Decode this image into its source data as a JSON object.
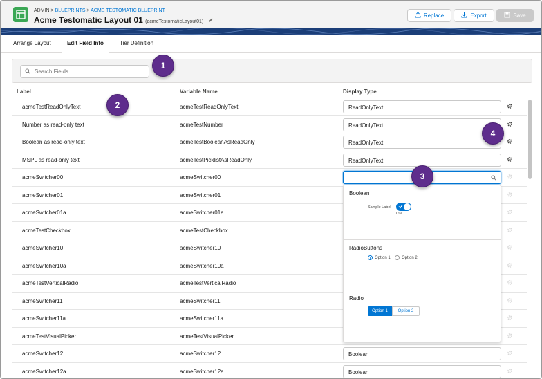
{
  "header": {
    "crumbs": {
      "root": "ADMIN",
      "sep1": ">",
      "blueprints": "BLUEPRINTS",
      "sep2": ">",
      "current": "ACME TESTOMATIC BLUEPRINT"
    },
    "title": "Acme Testomatic Layout 01",
    "api_name": "(acmeTestomaticLayout01)",
    "buttons": {
      "replace": "Replace",
      "export": "Export",
      "save": "Save"
    }
  },
  "tabs": [
    "Arrange Layout",
    "Edit Field Info",
    "Tier Definition"
  ],
  "active_tab": "Edit Field Info",
  "search": {
    "placeholder": "Search Fields",
    "value": ""
  },
  "columns": {
    "label": "Label",
    "variable": "Variable Name",
    "display": "Display Type"
  },
  "rows": [
    {
      "label": "acmeTestReadOnlyText",
      "variable": "acmeTestReadOnlyText",
      "display": "ReadOnlyText"
    },
    {
      "label": "Number as read-only text",
      "variable": "acmeTestNumber",
      "display": "ReadOnlyText"
    },
    {
      "label": "Boolean as read-only text",
      "variable": "acmeTestBooleanAsReadOnly",
      "display": "ReadOnlyText"
    },
    {
      "label": "MSPL as read-only text",
      "variable": "acmeTestPicklistAsReadOnly",
      "display": "ReadOnlyText"
    },
    {
      "label": "acmeSwitcher00",
      "variable": "acmeSwitcher00",
      "display": ""
    },
    {
      "label": "acmeSwitcher01",
      "variable": "acmeSwitcher01",
      "display": ""
    },
    {
      "label": "acmeSwitcher01a",
      "variable": "acmeSwitcher01a",
      "display": ""
    },
    {
      "label": "acmeTestCheckbox",
      "variable": "acmeTestCheckbox",
      "display": ""
    },
    {
      "label": "acmeSwitcher10",
      "variable": "acmeSwitcher10",
      "display": ""
    },
    {
      "label": "acmeSwitcher10a",
      "variable": "acmeSwitcher10a",
      "display": ""
    },
    {
      "label": "acmeTestVerticalRadio",
      "variable": "acmeTestVerticalRadio",
      "display": ""
    },
    {
      "label": "acmeSwitcher11",
      "variable": "acmeSwitcher11",
      "display": ""
    },
    {
      "label": "acmeSwitcher11a",
      "variable": "acmeSwitcher11a",
      "display": ""
    },
    {
      "label": "acmeTestVisualPicker",
      "variable": "acmeTestVisualPicker",
      "display": ""
    },
    {
      "label": "acmeSwitcher12",
      "variable": "acmeSwitcher12",
      "display": "Boolean"
    },
    {
      "label": "acmeSwitcher12a",
      "variable": "acmeSwitcher12a",
      "display": "Boolean"
    }
  ],
  "dropdown": {
    "options": [
      {
        "name": "Boolean",
        "sample_label": "Sample Label",
        "state": "True"
      },
      {
        "name": "RadioButtons",
        "choice1": "Option 1",
        "choice2": "Option 2"
      },
      {
        "name": "Radio",
        "choice1": "Option 1",
        "choice2": "Option 2"
      }
    ]
  },
  "callouts": [
    "1",
    "2",
    "3",
    "4"
  ],
  "colors": {
    "accent": "#0176d3",
    "app_icon": "#3ba755",
    "callout": "#5e2d8c",
    "banner": "#1b3e78"
  }
}
